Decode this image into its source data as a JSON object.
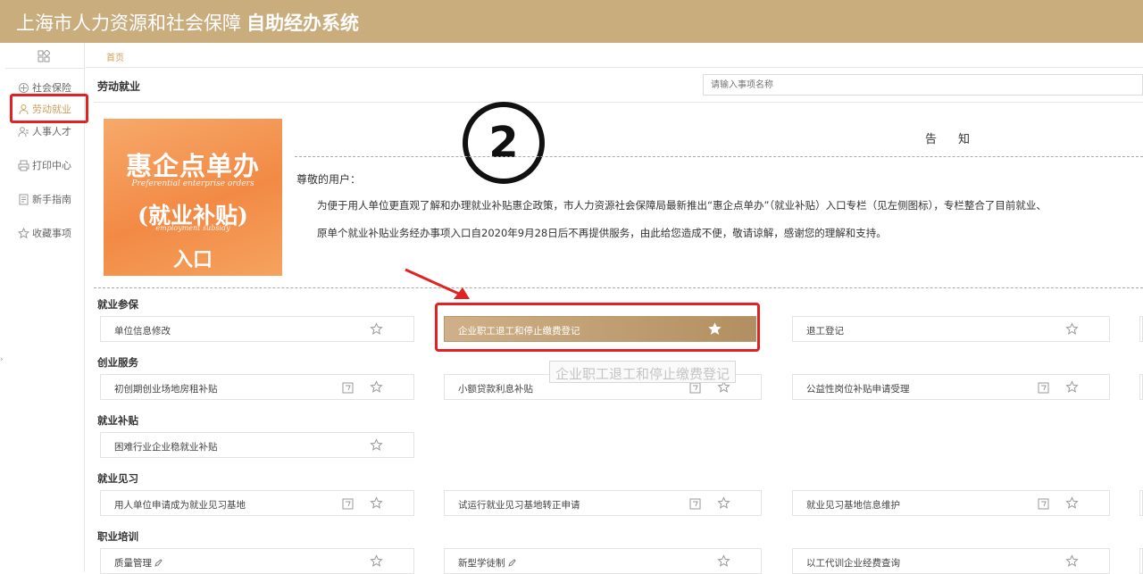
{
  "header": {
    "title_main": "上海市人力资源和社会保障",
    "title_bold": "自助经办系统"
  },
  "sidebar": {
    "items": [
      {
        "label": "社会保险",
        "icon": "social-insurance-icon"
      },
      {
        "label": "劳动就业",
        "icon": "employment-icon",
        "active": true
      },
      {
        "label": "人事人才",
        "icon": "talent-icon"
      },
      {
        "label": "打印中心",
        "icon": "printer-icon"
      },
      {
        "label": "新手指南",
        "icon": "guide-icon"
      },
      {
        "label": "收藏事项",
        "icon": "star-icon"
      }
    ]
  },
  "breadcrumb": "首页",
  "section_title": "劳动就业",
  "search": {
    "placeholder": "请输入事项名称"
  },
  "banner": {
    "line1": "惠企点单办",
    "en1": "Preferential enterprise orders",
    "line2": "(就业补贴)",
    "en2": "employment subsidy",
    "line3": "入口"
  },
  "annotation_number": "②",
  "notice": {
    "title": "告知",
    "greeting": "尊敬的用户：",
    "para1": "为便于用人单位更直观了解和办理就业补贴惠企政策，市人力资源社会保障局最新推出“惠企点单办”（就业补贴）入口专栏（见左侧图标），专栏整合了目前就业、",
    "para2": "原单个就业补贴业务经办事项入口自2020年9月28日后不再提供服务，由此给您造成不便，敬请谅解，感谢您的理解和支持。"
  },
  "categories": [
    {
      "title": "就业参保",
      "items": [
        "单位信息修改",
        "企业职工退工和停止缴费登记",
        "退工登记"
      ]
    },
    {
      "title": "创业服务",
      "items": [
        "初创期创业场地房租补贴",
        "小额贷款利息补贴",
        "公益性岗位补贴申请受理"
      ]
    },
    {
      "title": "就业补贴",
      "items": [
        "困难行业企业稳就业补贴"
      ]
    },
    {
      "title": "就业见习",
      "items": [
        "用人单位申请成为就业见习基地",
        "试运行就业见习基地转正申请",
        "就业见习基地信息维护"
      ]
    },
    {
      "title": "职业培训",
      "items": [
        "质量管理",
        "新型学徒制",
        "以工代训企业经费查询"
      ]
    }
  ],
  "tooltip": "企业职工退工和停止缴费登记",
  "colors": {
    "header": "#c9ad7d",
    "accent": "#c9a15c",
    "highlight": "#b28f60",
    "annotation": "#e02222"
  }
}
